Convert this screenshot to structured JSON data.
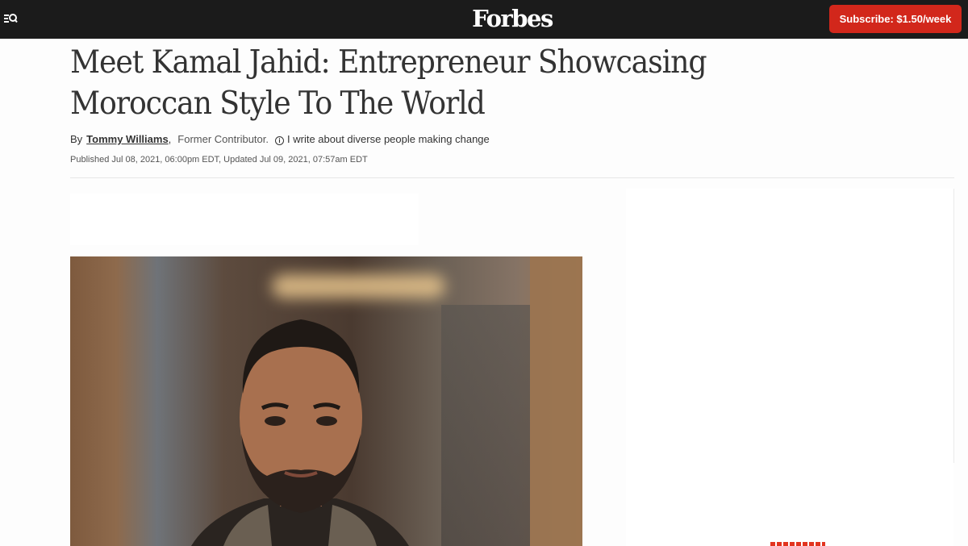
{
  "header": {
    "logo": "Forbes",
    "menu_icon": "menu-search-icon",
    "subscribe_label": "Subscribe: $1.50/week",
    "subscribe_color": "#d2271b"
  },
  "article": {
    "title": "Meet Kamal Jahid: Entrepreneur Showcasing Moroccan Style To The World",
    "byline_prefix": "By",
    "author": "Tommy Williams",
    "author_separator": ",",
    "role": "Former Contributor.",
    "info_icon": "info-icon",
    "tagline": "I write about diverse people making change",
    "published": "Published Jul 08, 2021, 06:00pm EDT, Updated Jul 09, 2021, 07:57am EDT"
  },
  "media": {
    "photo": "portrait-photo"
  }
}
